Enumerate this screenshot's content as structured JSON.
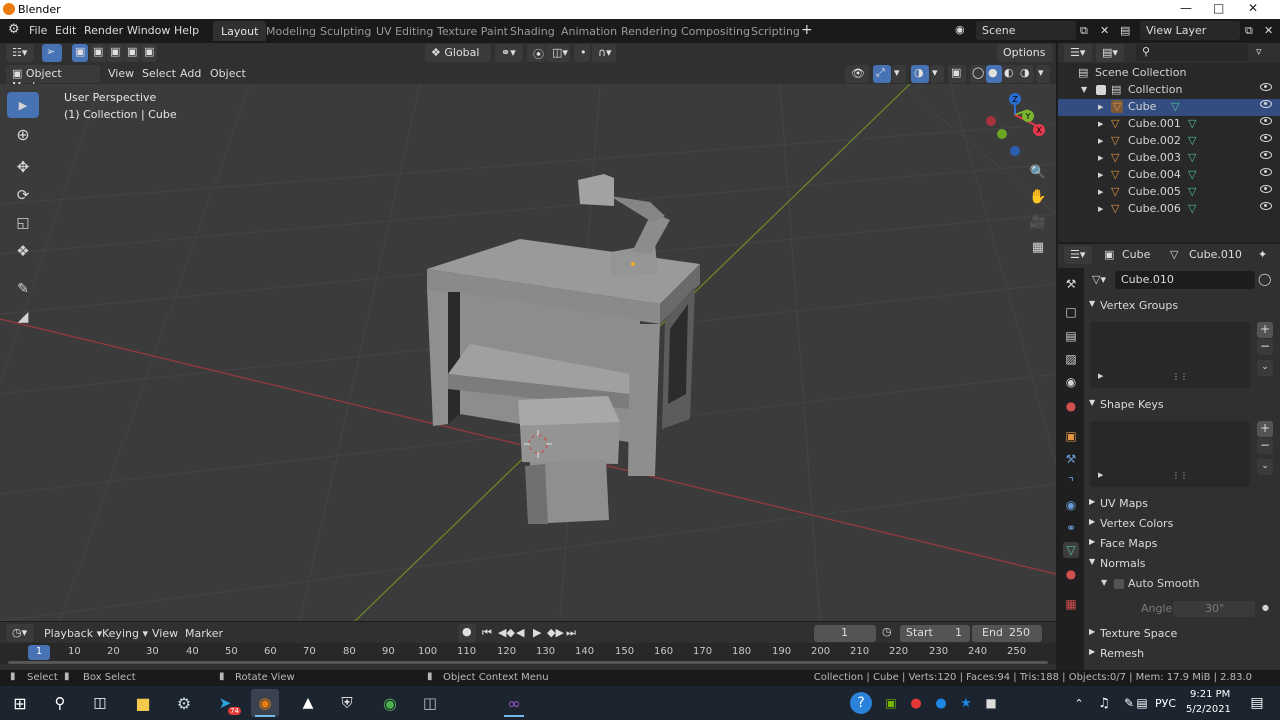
{
  "window": {
    "title": "Blender"
  },
  "menu": {
    "items": [
      "File",
      "Edit",
      "Render",
      "Window",
      "Help"
    ],
    "workspaces": [
      "Layout",
      "Modeling",
      "Sculpting",
      "UV Editing",
      "Texture Paint",
      "Shading",
      "Animation",
      "Rendering",
      "Compositing",
      "Scripting"
    ],
    "add_workspace": "+",
    "scene": "Scene",
    "view_layer": "View Layer"
  },
  "viewport": {
    "mode": "Object Mode",
    "menus": [
      "View",
      "Select",
      "Add",
      "Object"
    ],
    "transform_orientation": "Global",
    "options_label": "Options",
    "overlay_title": "User Perspective",
    "overlay_subtitle": "(1) Collection | Cube"
  },
  "gizmo": {
    "x": "X",
    "y": "Y",
    "z": "Z"
  },
  "outliner": {
    "root": "Scene Collection",
    "collection": "Collection",
    "objects": [
      "Cube",
      "Cube.001",
      "Cube.002",
      "Cube.003",
      "Cube.004",
      "Cube.005",
      "Cube.006"
    ]
  },
  "properties": {
    "object_name": "Cube",
    "mesh_name": "Cube.010",
    "datablock": "Cube.010",
    "panels": {
      "vertex_groups": "Vertex Groups",
      "shape_keys": "Shape Keys",
      "uv_maps": "UV Maps",
      "vertex_colors": "Vertex Colors",
      "face_maps": "Face Maps",
      "normals": "Normals",
      "auto_smooth": "Auto Smooth",
      "angle_label": "Angle",
      "angle_value": "30°",
      "texture_space": "Texture Space",
      "remesh": "Remesh"
    }
  },
  "timeline": {
    "menus": [
      "Playback",
      "Keying",
      "View",
      "Marker"
    ],
    "current_frame": "1",
    "start_label": "Start",
    "start_value": "1",
    "end_label": "End",
    "end_value": "250",
    "ruler_ticks": [
      "1",
      "10",
      "20",
      "30",
      "40",
      "50",
      "60",
      "70",
      "80",
      "90",
      "100",
      "110",
      "120",
      "130",
      "140",
      "150",
      "160",
      "170",
      "180",
      "190",
      "200",
      "210",
      "220",
      "230",
      "240",
      "250"
    ]
  },
  "statusbar": {
    "select": "Select",
    "box_select": "Box Select",
    "rotate_view": "Rotate View",
    "context_menu": "Object Context Menu",
    "stats": "Collection | Cube | Verts:120 | Faces:94 | Tris:188 | Objects:0/7 | Mem: 17.9 MiB | 2.83.0"
  },
  "taskbar": {
    "time": "9:21 PM",
    "date": "5/2/2021",
    "language": "РУС",
    "telegram_badge": "74"
  },
  "colors": {
    "accent": "#4772b3",
    "x_axis": "#9a3a3f",
    "y_axis": "#7a9a2a",
    "mesh_icon": "#e69543",
    "data_icon": "#4fc29a"
  }
}
